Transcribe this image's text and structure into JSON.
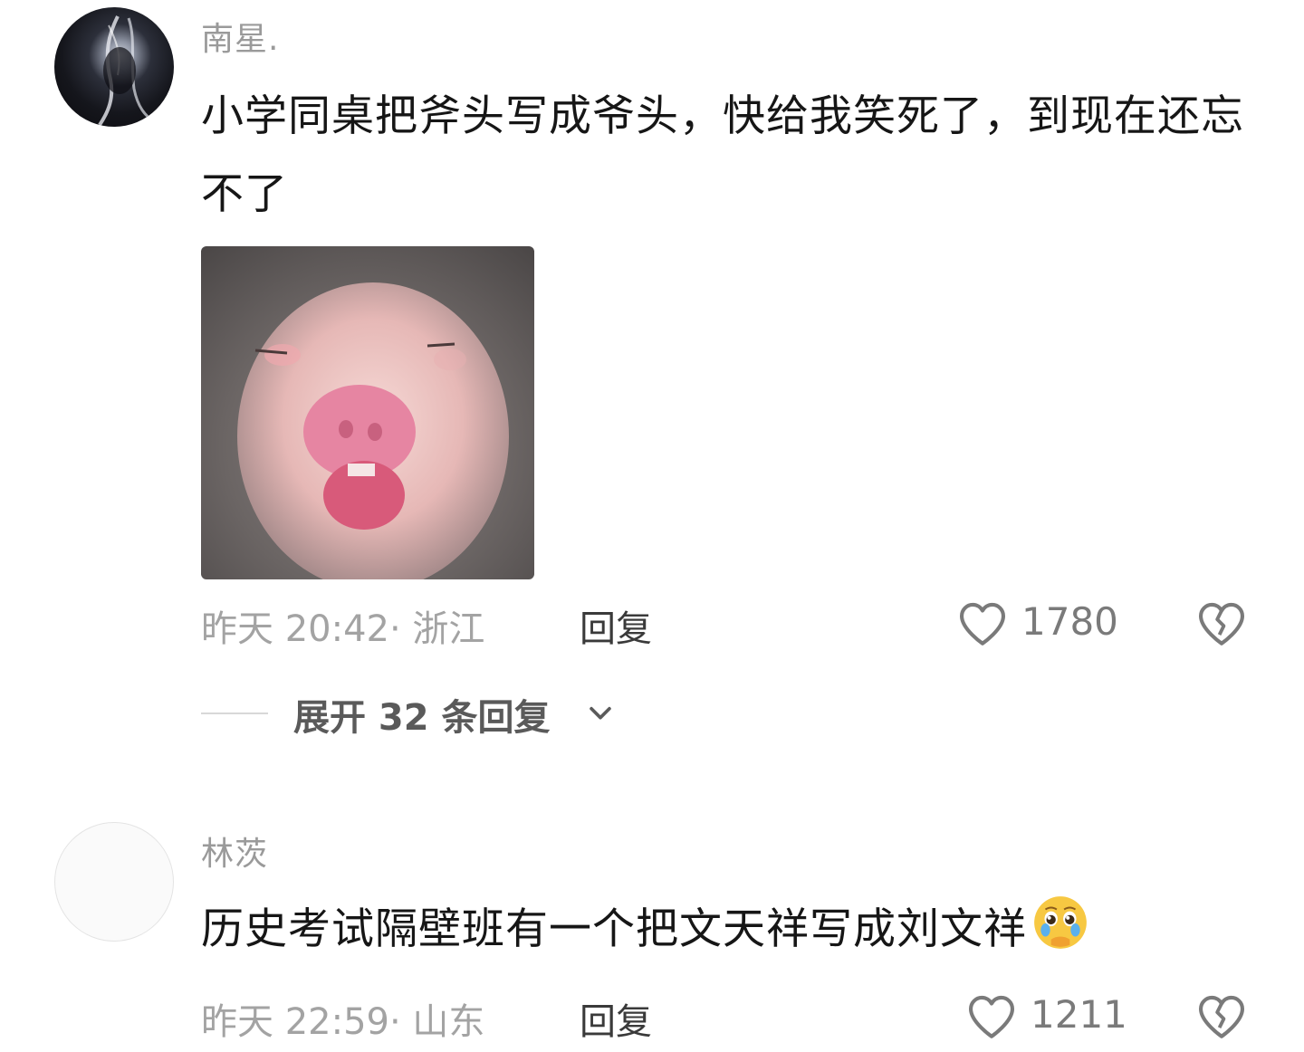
{
  "comments": [
    {
      "username": "南星.",
      "text": "小学同桌把斧头写成爷头，快给我笑死了，到现在还忘不了",
      "meta": "昨天 20:42· 浙江",
      "reply_label": "回复",
      "like_count": "1780",
      "expand_label": "展开 32 条回复"
    },
    {
      "username": "林茨",
      "text": "历史考试隔壁班有一个把文天祥写成刘文祥",
      "meta": "昨天 22:59· 山东",
      "reply_label": "回复",
      "like_count": "1211"
    }
  ],
  "icons": {
    "like": "heart-outline-icon",
    "dislike": "broken-heart-icon",
    "expand": "chevron-down-icon",
    "emoji": "pleading-face-emoji"
  },
  "colors": {
    "text_primary": "#161616",
    "text_secondary": "#9a9a9a",
    "reply_text": "#3a3a3a",
    "icon_gray": "#7a7a7a"
  }
}
